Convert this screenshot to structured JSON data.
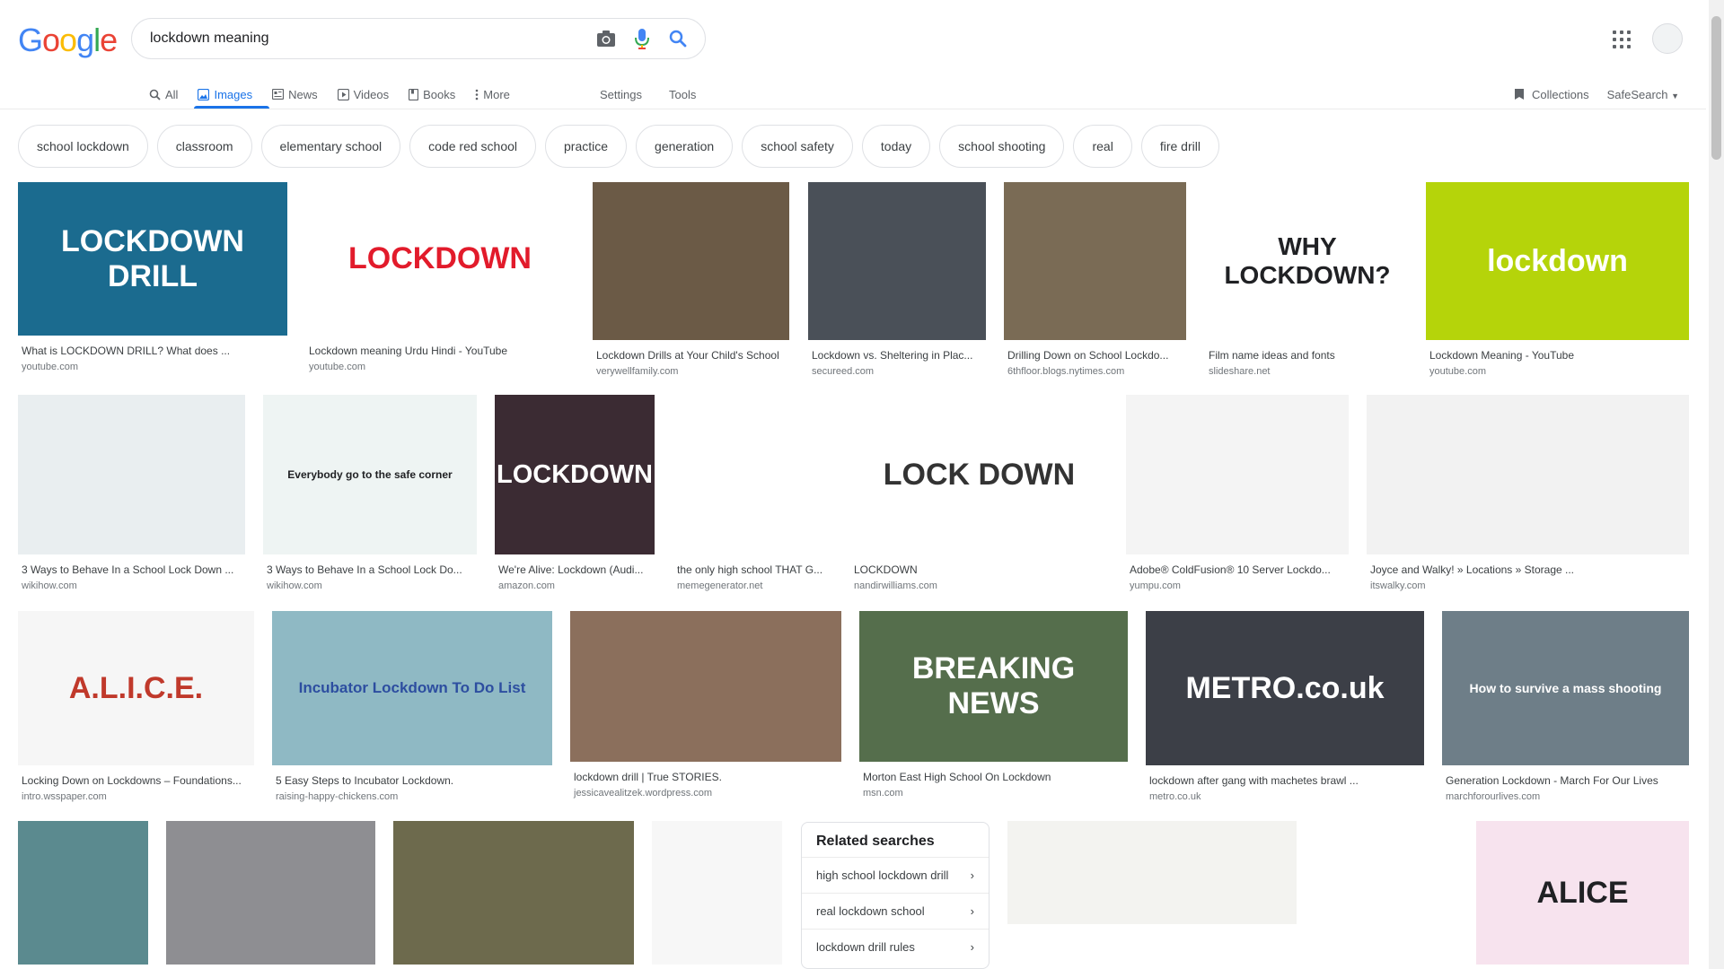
{
  "logo": {
    "letters": [
      "G",
      "o",
      "o",
      "g",
      "l",
      "e"
    ],
    "colors": [
      "#4285f4",
      "#ea4335",
      "#fbbc05",
      "#4285f4",
      "#34a853",
      "#ea4335"
    ]
  },
  "search": {
    "query": "lockdown meaning"
  },
  "nav": {
    "tabs": [
      {
        "label": "All",
        "icon": "search-icon"
      },
      {
        "label": "Images",
        "icon": "image-icon",
        "active": true
      },
      {
        "label": "News",
        "icon": "news-icon"
      },
      {
        "label": "Videos",
        "icon": "play-icon"
      },
      {
        "label": "Books",
        "icon": "book-icon"
      },
      {
        "label": "More",
        "icon": "kebab-icon"
      }
    ],
    "settings": "Settings",
    "tools": "Tools",
    "collections": "Collections",
    "safesearch": "SafeSearch"
  },
  "chips": [
    "school lockdown",
    "classroom",
    "elementary school",
    "code red school",
    "practice",
    "generation",
    "school safety",
    "today",
    "school shooting",
    "real",
    "fire drill"
  ],
  "results": [
    {
      "title": "What is LOCKDOWN DRILL? What does ...",
      "source": "youtube.com",
      "thumb_text": "LOCKDOWN DRILL",
      "bg": "#1b6b8f",
      "fg": "#ffffff"
    },
    {
      "title": "Lockdown meaning Urdu Hindi - YouTube",
      "source": "youtube.com",
      "thumb_text": "LOCKDOWN",
      "bg": "#ffffff",
      "fg": "#e21b2b"
    },
    {
      "title": "Lockdown Drills at Your Child's School",
      "source": "verywellfamily.com",
      "thumb_text": "",
      "bg": "#6b5a46",
      "fg": "#ffffff"
    },
    {
      "title": "Lockdown vs. Sheltering in Plac...",
      "source": "secureed.com",
      "thumb_text": "",
      "bg": "#4a5058",
      "fg": "#ffffff"
    },
    {
      "title": "Drilling Down on School Lockdo...",
      "source": "6thfloor.blogs.nytimes.com",
      "thumb_text": "",
      "bg": "#7a6b55",
      "fg": "#ffffff"
    },
    {
      "title": "Film name ideas and fonts",
      "source": "slideshare.net",
      "thumb_text": "WHY LOCKDOWN?",
      "bg": "#ffffff",
      "fg": "#202124"
    },
    {
      "title": "Lockdown Meaning - YouTube",
      "source": "youtube.com",
      "thumb_text": "lockdown",
      "bg": "#b5d40a",
      "fg": "#ffffff"
    },
    {
      "title": "3 Ways to Behave In a School Lock Down ...",
      "source": "wikihow.com",
      "thumb_text": "",
      "bg": "#e9eef0",
      "fg": "#202124"
    },
    {
      "title": "3 Ways to Behave In a School Lock Do...",
      "source": "wikihow.com",
      "thumb_text": "Everybody go to the safe corner",
      "bg": "#eef4f3",
      "fg": "#202124"
    },
    {
      "title": "We're Alive: Lockdown (Audi...",
      "source": "amazon.com",
      "thumb_text": "LOCKDOWN",
      "bg": "#3b2b33",
      "fg": "#ffffff"
    },
    {
      "title": "the only high school THAT G...",
      "source": "memegenerator.net",
      "thumb_text": "",
      "bg": "#ffffff",
      "fg": "#000000"
    },
    {
      "title": "LOCKDOWN",
      "source": "nandirwilliams.com",
      "thumb_text": "LOCK DOWN",
      "bg": "#ffffff",
      "fg": "#333333"
    },
    {
      "title": "Adobe® ColdFusion® 10 Server Lockdo...",
      "source": "yumpu.com",
      "thumb_text": "",
      "bg": "#f4f4f4",
      "fg": "#202124"
    },
    {
      "title": "Joyce and Walky! » Locations » Storage ...",
      "source": "itswalky.com",
      "thumb_text": "",
      "bg": "#f2f2f2",
      "fg": "#202124"
    },
    {
      "title": "Locking Down on Lockdowns – Foundations...",
      "source": "intro.wsspaper.com",
      "thumb_text": "A.L.I.C.E.",
      "bg": "#f6f6f6",
      "fg": "#c0392b"
    },
    {
      "title": "5 Easy Steps to Incubator Lockdown.",
      "source": "raising-happy-chickens.com",
      "thumb_text": "Incubator Lockdown To Do List",
      "bg": "#8fb9c4",
      "fg": "#2d4ea0"
    },
    {
      "title": "lockdown drill | True STORIES.",
      "source": "jessicavealitzek.wordpress.com",
      "thumb_text": "",
      "bg": "#8b6f5c",
      "fg": "#ffffff"
    },
    {
      "title": "Morton East High School On Lockdown",
      "source": "msn.com",
      "thumb_text": "BREAKING NEWS",
      "bg": "#556e4c",
      "fg": "#ffffff"
    },
    {
      "title": "lockdown after gang with machetes brawl ...",
      "source": "metro.co.uk",
      "thumb_text": "METRO.co.uk",
      "bg": "#3c3f47",
      "fg": "#ffffff"
    },
    {
      "title": "Generation Lockdown - March For Our Lives",
      "source": "marchforourlives.com",
      "thumb_text": "How to survive a mass shooting",
      "bg": "#6e7e88",
      "fg": "#ffffff"
    },
    {
      "title": "",
      "source": "",
      "thumb_text": "",
      "bg": "#5b8a8f",
      "fg": "#ffffff"
    },
    {
      "title": "",
      "source": "",
      "thumb_text": "",
      "bg": "#8e8e92",
      "fg": "#ffffff"
    },
    {
      "title": "",
      "source": "",
      "thumb_text": "",
      "bg": "#6d6a4d",
      "fg": "#ffffff"
    },
    {
      "title": "",
      "source": "",
      "thumb_text": "",
      "bg": "#f7f7f7",
      "fg": "#202124"
    },
    {
      "title": "",
      "source": "",
      "thumb_text": "",
      "bg": "#f3f3f0",
      "fg": "#202124"
    },
    {
      "title": "",
      "source": "",
      "thumb_text": "",
      "bg": "#ffffff",
      "fg": "#202124"
    },
    {
      "title": "",
      "source": "",
      "thumb_text": "ALICE",
      "bg": "#f7e3ee",
      "fg": "#202124"
    }
  ],
  "related": {
    "heading": "Related searches",
    "items": [
      "high school lockdown drill",
      "real lockdown school",
      "lockdown drill rules"
    ]
  }
}
